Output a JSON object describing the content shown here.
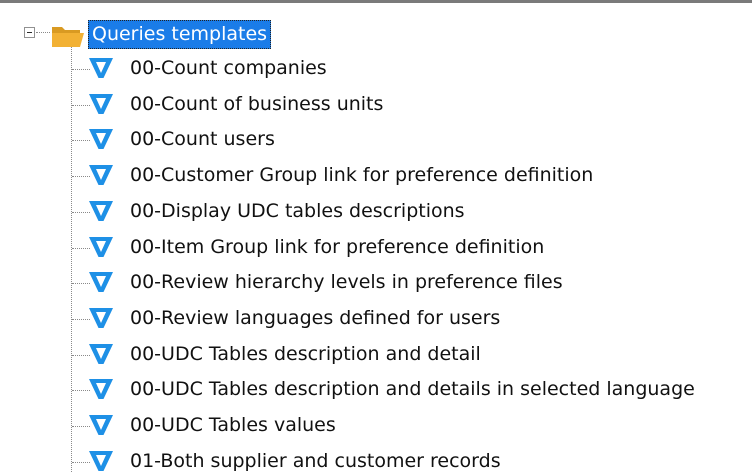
{
  "tree": {
    "root": {
      "label": "Queries templates",
      "expander_symbol": "minus",
      "icon": "folder-open-icon",
      "selected": true
    },
    "items": [
      {
        "label": "00-Count companies",
        "icon": "query-filter-icon"
      },
      {
        "label": "00-Count of business units",
        "icon": "query-filter-icon"
      },
      {
        "label": "00-Count users",
        "icon": "query-filter-icon"
      },
      {
        "label": "00-Customer Group link for preference definition",
        "icon": "query-filter-icon"
      },
      {
        "label": "00-Display UDC tables descriptions",
        "icon": "query-filter-icon"
      },
      {
        "label": "00-Item Group link for preference definition",
        "icon": "query-filter-icon"
      },
      {
        "label": "00-Review hierarchy levels in preference files",
        "icon": "query-filter-icon"
      },
      {
        "label": "00-Review languages defined for users",
        "icon": "query-filter-icon"
      },
      {
        "label": "00-UDC Tables description and detail",
        "icon": "query-filter-icon"
      },
      {
        "label": "00-UDC Tables description and details in selected language",
        "icon": "query-filter-icon"
      },
      {
        "label": "00-UDC Tables values",
        "icon": "query-filter-icon"
      },
      {
        "label": "01-Both supplier and customer records",
        "icon": "query-filter-icon"
      }
    ]
  },
  "colors": {
    "selection_bg": "#1a7ce8",
    "selection_text": "#ffffff",
    "query_icon": "#1e90e6",
    "folder": "#f2b134",
    "text": "#111111"
  }
}
